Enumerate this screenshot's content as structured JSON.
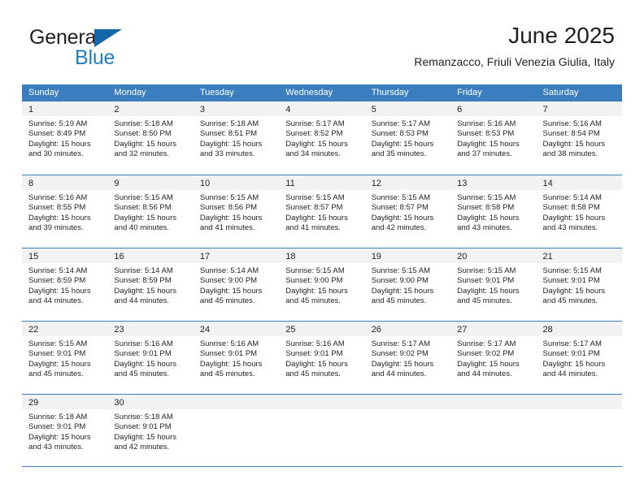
{
  "brand": {
    "name_top": "General",
    "name_bottom": "Blue",
    "flag_icon": "blue-flag-icon",
    "color_text": "#231f20",
    "color_accent": "#1f7fc4"
  },
  "header": {
    "title": "June 2025",
    "subtitle": "Remanzacco, Friuli Venezia Giulia, Italy"
  },
  "theme": {
    "header_blue": "#3b7ebf",
    "daynumber_band": "#f2f2f2",
    "cell_background": "#ffffff",
    "text": "#231f20"
  },
  "weekdays": [
    "Sunday",
    "Monday",
    "Tuesday",
    "Wednesday",
    "Thursday",
    "Friday",
    "Saturday"
  ],
  "weeks": [
    [
      {
        "day": "1",
        "sunrise": "Sunrise: 5:19 AM",
        "sunset": "Sunset: 8:49 PM",
        "daylight": "Daylight: 15 hours and 30 minutes."
      },
      {
        "day": "2",
        "sunrise": "Sunrise: 5:18 AM",
        "sunset": "Sunset: 8:50 PM",
        "daylight": "Daylight: 15 hours and 32 minutes."
      },
      {
        "day": "3",
        "sunrise": "Sunrise: 5:18 AM",
        "sunset": "Sunset: 8:51 PM",
        "daylight": "Daylight: 15 hours and 33 minutes."
      },
      {
        "day": "4",
        "sunrise": "Sunrise: 5:17 AM",
        "sunset": "Sunset: 8:52 PM",
        "daylight": "Daylight: 15 hours and 34 minutes."
      },
      {
        "day": "5",
        "sunrise": "Sunrise: 5:17 AM",
        "sunset": "Sunset: 8:53 PM",
        "daylight": "Daylight: 15 hours and 35 minutes."
      },
      {
        "day": "6",
        "sunrise": "Sunrise: 5:16 AM",
        "sunset": "Sunset: 8:53 PM",
        "daylight": "Daylight: 15 hours and 37 minutes."
      },
      {
        "day": "7",
        "sunrise": "Sunrise: 5:16 AM",
        "sunset": "Sunset: 8:54 PM",
        "daylight": "Daylight: 15 hours and 38 minutes."
      }
    ],
    [
      {
        "day": "8",
        "sunrise": "Sunrise: 5:16 AM",
        "sunset": "Sunset: 8:55 PM",
        "daylight": "Daylight: 15 hours and 39 minutes."
      },
      {
        "day": "9",
        "sunrise": "Sunrise: 5:15 AM",
        "sunset": "Sunset: 8:56 PM",
        "daylight": "Daylight: 15 hours and 40 minutes."
      },
      {
        "day": "10",
        "sunrise": "Sunrise: 5:15 AM",
        "sunset": "Sunset: 8:56 PM",
        "daylight": "Daylight: 15 hours and 41 minutes."
      },
      {
        "day": "11",
        "sunrise": "Sunrise: 5:15 AM",
        "sunset": "Sunset: 8:57 PM",
        "daylight": "Daylight: 15 hours and 41 minutes."
      },
      {
        "day": "12",
        "sunrise": "Sunrise: 5:15 AM",
        "sunset": "Sunset: 8:57 PM",
        "daylight": "Daylight: 15 hours and 42 minutes."
      },
      {
        "day": "13",
        "sunrise": "Sunrise: 5:15 AM",
        "sunset": "Sunset: 8:58 PM",
        "daylight": "Daylight: 15 hours and 43 minutes."
      },
      {
        "day": "14",
        "sunrise": "Sunrise: 5:14 AM",
        "sunset": "Sunset: 8:58 PM",
        "daylight": "Daylight: 15 hours and 43 minutes."
      }
    ],
    [
      {
        "day": "15",
        "sunrise": "Sunrise: 5:14 AM",
        "sunset": "Sunset: 8:59 PM",
        "daylight": "Daylight: 15 hours and 44 minutes."
      },
      {
        "day": "16",
        "sunrise": "Sunrise: 5:14 AM",
        "sunset": "Sunset: 8:59 PM",
        "daylight": "Daylight: 15 hours and 44 minutes."
      },
      {
        "day": "17",
        "sunrise": "Sunrise: 5:14 AM",
        "sunset": "Sunset: 9:00 PM",
        "daylight": "Daylight: 15 hours and 45 minutes."
      },
      {
        "day": "18",
        "sunrise": "Sunrise: 5:15 AM",
        "sunset": "Sunset: 9:00 PM",
        "daylight": "Daylight: 15 hours and 45 minutes."
      },
      {
        "day": "19",
        "sunrise": "Sunrise: 5:15 AM",
        "sunset": "Sunset: 9:00 PM",
        "daylight": "Daylight: 15 hours and 45 minutes."
      },
      {
        "day": "20",
        "sunrise": "Sunrise: 5:15 AM",
        "sunset": "Sunset: 9:01 PM",
        "daylight": "Daylight: 15 hours and 45 minutes."
      },
      {
        "day": "21",
        "sunrise": "Sunrise: 5:15 AM",
        "sunset": "Sunset: 9:01 PM",
        "daylight": "Daylight: 15 hours and 45 minutes."
      }
    ],
    [
      {
        "day": "22",
        "sunrise": "Sunrise: 5:15 AM",
        "sunset": "Sunset: 9:01 PM",
        "daylight": "Daylight: 15 hours and 45 minutes."
      },
      {
        "day": "23",
        "sunrise": "Sunrise: 5:16 AM",
        "sunset": "Sunset: 9:01 PM",
        "daylight": "Daylight: 15 hours and 45 minutes."
      },
      {
        "day": "24",
        "sunrise": "Sunrise: 5:16 AM",
        "sunset": "Sunset: 9:01 PM",
        "daylight": "Daylight: 15 hours and 45 minutes."
      },
      {
        "day": "25",
        "sunrise": "Sunrise: 5:16 AM",
        "sunset": "Sunset: 9:01 PM",
        "daylight": "Daylight: 15 hours and 45 minutes."
      },
      {
        "day": "26",
        "sunrise": "Sunrise: 5:17 AM",
        "sunset": "Sunset: 9:02 PM",
        "daylight": "Daylight: 15 hours and 44 minutes."
      },
      {
        "day": "27",
        "sunrise": "Sunrise: 5:17 AM",
        "sunset": "Sunset: 9:02 PM",
        "daylight": "Daylight: 15 hours and 44 minutes."
      },
      {
        "day": "28",
        "sunrise": "Sunrise: 5:17 AM",
        "sunset": "Sunset: 9:01 PM",
        "daylight": "Daylight: 15 hours and 44 minutes."
      }
    ],
    [
      {
        "day": "29",
        "sunrise": "Sunrise: 5:18 AM",
        "sunset": "Sunset: 9:01 PM",
        "daylight": "Daylight: 15 hours and 43 minutes."
      },
      {
        "day": "30",
        "sunrise": "Sunrise: 5:18 AM",
        "sunset": "Sunset: 9:01 PM",
        "daylight": "Daylight: 15 hours and 42 minutes."
      },
      {
        "day": "",
        "sunrise": "",
        "sunset": "",
        "daylight": ""
      },
      {
        "day": "",
        "sunrise": "",
        "sunset": "",
        "daylight": ""
      },
      {
        "day": "",
        "sunrise": "",
        "sunset": "",
        "daylight": ""
      },
      {
        "day": "",
        "sunrise": "",
        "sunset": "",
        "daylight": ""
      },
      {
        "day": "",
        "sunrise": "",
        "sunset": "",
        "daylight": ""
      }
    ]
  ]
}
